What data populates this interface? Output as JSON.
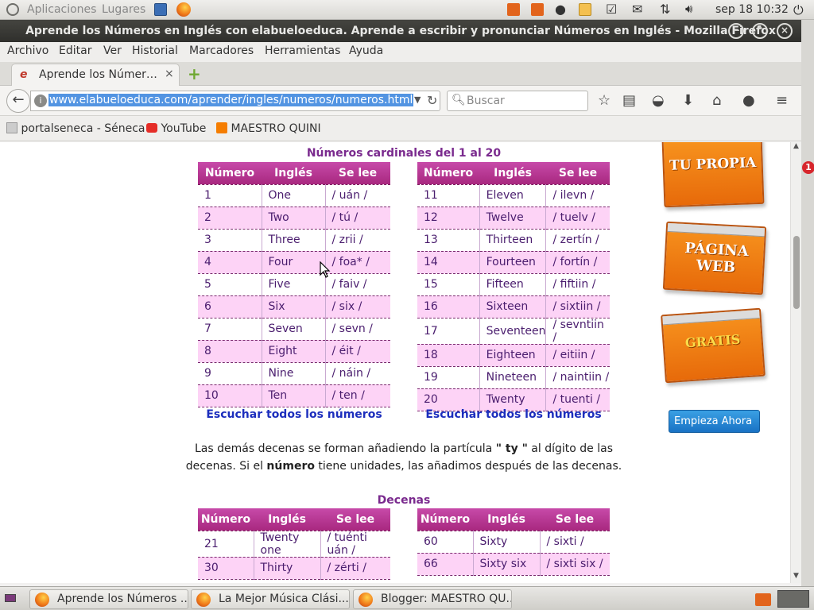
{
  "panel": {
    "apps": "Aplicaciones",
    "places": "Lugares",
    "datetime": "sep 18 10:32"
  },
  "window": {
    "title": "Aprende los Números en Inglés con elabueloeduca. Aprende a escribir y pronunciar Números en Inglés - Mozilla Firefox"
  },
  "menu": [
    "Archivo",
    "Editar",
    "Ver",
    "Historial",
    "Marcadores",
    "Herramientas",
    "Ayuda"
  ],
  "tab": {
    "title": "Aprende los Númer…"
  },
  "nav": {
    "url": "www.elabueloeduca.com/aprender/ingles/numeros/numeros.html",
    "search_placeholder": "Buscar"
  },
  "bookmarks": [
    "portalseneca - Séneca",
    "YouTube",
    "MAESTRO QUINI"
  ],
  "page": {
    "section1": "Números cardinales del 1 al 20",
    "headers": [
      "Número",
      "Inglés",
      "Se lee"
    ],
    "left_rows": [
      [
        "1",
        "One",
        "/ uán /"
      ],
      [
        "2",
        "Two",
        "/ tú /"
      ],
      [
        "3",
        "Three",
        "/ zrii /"
      ],
      [
        "4",
        "Four",
        "/ foa* /"
      ],
      [
        "5",
        "Five",
        "/ faiv /"
      ],
      [
        "6",
        "Six",
        "/ six /"
      ],
      [
        "7",
        "Seven",
        "/ sevn /"
      ],
      [
        "8",
        "Eight",
        "/ éit /"
      ],
      [
        "9",
        "Nine",
        "/ náin /"
      ],
      [
        "10",
        "Ten",
        "/ ten /"
      ]
    ],
    "right_rows": [
      [
        "11",
        "Eleven",
        "/ ilevn /"
      ],
      [
        "12",
        "Twelve",
        "/ tuelv /"
      ],
      [
        "13",
        "Thirteen",
        "/ zertín /"
      ],
      [
        "14",
        "Fourteen",
        "/ fortín /"
      ],
      [
        "15",
        "Fifteen",
        "/ fiftiin /"
      ],
      [
        "16",
        "Sixteen",
        "/ sixtiin /"
      ],
      [
        "17",
        "Seventeen",
        "/ sevntiin /"
      ],
      [
        "18",
        "Eighteen",
        "/ eitiin /"
      ],
      [
        "19",
        "Nineteen",
        "/ naintiin /"
      ],
      [
        "20",
        "Twenty",
        "/ tuenti /"
      ]
    ],
    "listen": "Escuchar todos los números",
    "para_a": "Las demás decenas se forman añadiendo la partícula ",
    "para_ty": "\" ty \"",
    "para_b": " al dígito de las",
    "para_c": "decenas. Si el ",
    "para_num": "número",
    "para_d": " tiene unidades, las añadimos después de las decenas.",
    "section2": "Decenas",
    "dec_left_rows": [
      [
        "21",
        "Twenty one",
        "/ tuénti uán /"
      ],
      [
        "30",
        "Thirty",
        "/ zérti /"
      ]
    ],
    "dec_right_rows": [
      [
        "60",
        "Sixty",
        "/ sixti /"
      ],
      [
        "66",
        "Sixty six",
        "/ sixti six /"
      ]
    ]
  },
  "ad": {
    "card1": "TU PROPIA",
    "card2": "PÁGINA WEB",
    "card3": "GRATIS",
    "cta": "Empieza Ahora"
  },
  "notification_count": "1",
  "taskbar": [
    "Aprende los Números ...",
    "La Mejor Música Clási...",
    "Blogger: MAESTRO QU..."
  ],
  "colors": {
    "table_header": "#b8338f",
    "row_alt": "#fdd3f6",
    "section_title": "#7a2a8e",
    "link_blue": "#1c2ebd",
    "ad_orange": "#f07d12"
  }
}
